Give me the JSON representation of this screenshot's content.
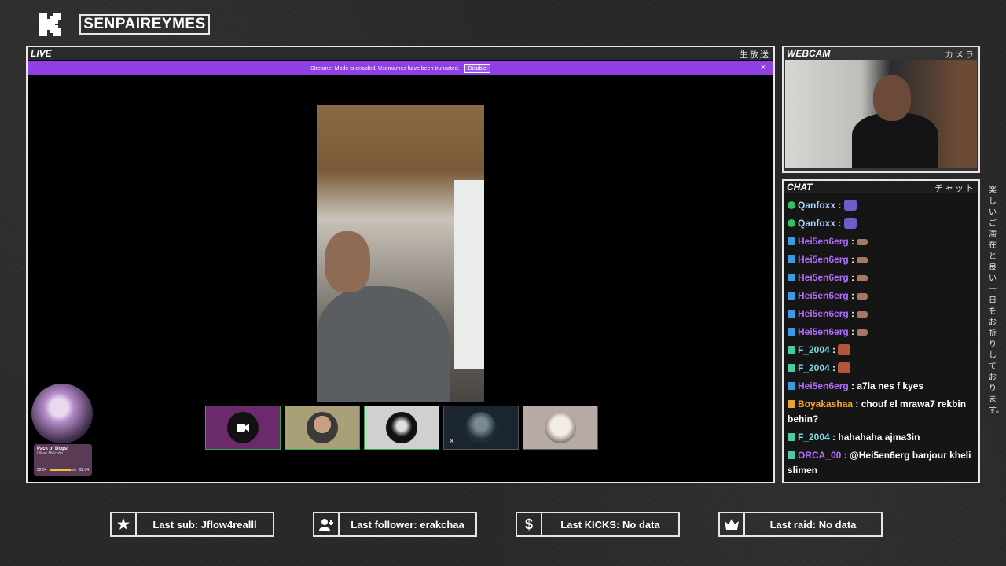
{
  "header": {
    "channel_name": "SENPAIREYMES"
  },
  "live_panel": {
    "title": "LIVE",
    "title_jp": "生放送",
    "streamer_notice": "Streamer Mode is enabled. Usernames have been truncated.",
    "disable_label": "Disable",
    "close_glyph": "×"
  },
  "now_playing": {
    "title": "Pack of Dogs!",
    "artist": "Oliver Malcolm",
    "elapsed": "02:04",
    "duration": "02:34",
    "progress": 0.8
  },
  "webcam_panel": {
    "title": "WEBCAM",
    "title_jp": "カメラ"
  },
  "chat_panel": {
    "title": "CHAT",
    "title_jp": "チャット",
    "messages": [
      {
        "user": "Qanfoxx",
        "color": "#a8d0ff",
        "badge": "ok",
        "text": "",
        "emote": "gg"
      },
      {
        "user": "Qanfoxx",
        "color": "#a8d0ff",
        "badge": "ok",
        "text": "",
        "emote": "gg"
      },
      {
        "user": "Hei5en6erg",
        "color": "#b06cff",
        "badge": "sub",
        "text": "",
        "emote": "tiny"
      },
      {
        "user": "Hei5en6erg",
        "color": "#b06cff",
        "badge": "sub",
        "text": "",
        "emote": "tiny"
      },
      {
        "user": "Hei5en6erg",
        "color": "#b06cff",
        "badge": "sub",
        "text": "",
        "emote": "tiny"
      },
      {
        "user": "Hei5en6erg",
        "color": "#b06cff",
        "badge": "sub",
        "text": "",
        "emote": "tiny"
      },
      {
        "user": "Hei5en6erg",
        "color": "#b06cff",
        "badge": "sub",
        "text": "",
        "emote": "tiny"
      },
      {
        "user": "Hei5en6erg",
        "color": "#b06cff",
        "badge": "sub",
        "text": "",
        "emote": "tiny"
      },
      {
        "user": "F_2004",
        "color": "#7fd8e8",
        "badge": "og",
        "text": "",
        "emote": "face"
      },
      {
        "user": "F_2004",
        "color": "#7fd8e8",
        "badge": "og",
        "text": "",
        "emote": "face"
      },
      {
        "user": "Hei5en6erg",
        "color": "#b06cff",
        "badge": "sub",
        "text": "a7la nes f kyes",
        "emote": ""
      },
      {
        "user": "Boyakashaa",
        "color": "#f5a623",
        "badge": "gold",
        "text": "chouf el mrawa7 rekbin behin?",
        "emote": ""
      },
      {
        "user": "F_2004",
        "color": "#7fd8e8",
        "badge": "og",
        "text": "hahahaha ajma3in",
        "emote": ""
      },
      {
        "user": "ORCA_00",
        "color": "#b06cff",
        "badge": "og",
        "text": "@Hei5en6erg banjour kheli slimen",
        "emote": ""
      }
    ]
  },
  "side_text_jp": "楽しいご滞在と良い一日をお祈りしております。",
  "stats": {
    "last_sub": "Last sub: Jflow4realll",
    "last_follower": "Last follower: erakchaa",
    "last_kicks": "Last KICKS: No data",
    "last_raid": "Last raid: No data"
  },
  "icons": {
    "logo": "kick-logo-icon",
    "sub": "star-icon",
    "follower": "user-plus-icon",
    "kicks": "dollar-icon",
    "raid": "crown-icon"
  }
}
